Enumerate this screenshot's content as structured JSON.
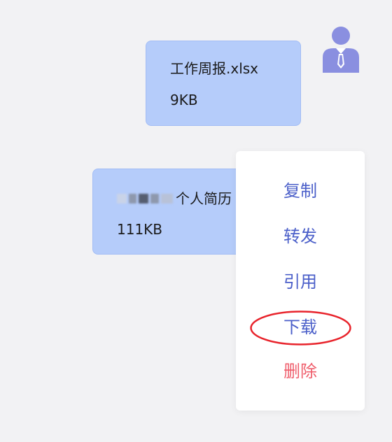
{
  "messages": [
    {
      "file_name": "工作周报.xlsx",
      "file_size": "9KB"
    },
    {
      "file_name_visible": "个人简历",
      "file_size": "111KB"
    }
  ],
  "context_menu": {
    "items": [
      {
        "label": "复制"
      },
      {
        "label": "转发"
      },
      {
        "label": "引用"
      },
      {
        "label": "下载",
        "highlighted": true
      },
      {
        "label": "删除",
        "danger": true
      }
    ]
  },
  "avatar": {
    "icon": "business-user-avatar-icon"
  },
  "colors": {
    "background": "#f2f2f4",
    "bubble": "#b5ccfa",
    "menu_text": "#4b5fc9",
    "danger_text": "#ef5d6b",
    "avatar": "#8a8fe0",
    "highlight_ring": "#e8232b"
  }
}
